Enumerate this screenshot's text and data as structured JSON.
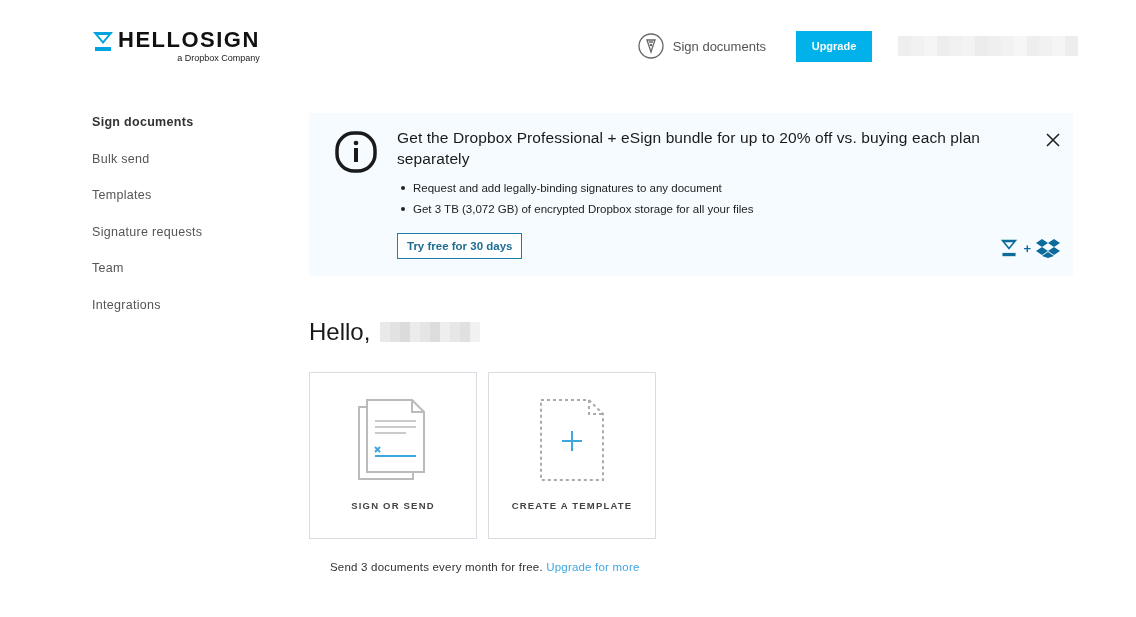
{
  "header": {
    "logo": {
      "name": "HELLOSIGN",
      "tagline": "a Dropbox Company"
    },
    "sign_link": "Sign documents",
    "upgrade_button": "Upgrade"
  },
  "sidebar": {
    "items": [
      {
        "label": "Sign documents",
        "selected": true
      },
      {
        "label": "Bulk send",
        "selected": false
      },
      {
        "label": "Templates",
        "selected": false
      },
      {
        "label": "Signature requests",
        "selected": false
      },
      {
        "label": "Team",
        "selected": false
      },
      {
        "label": "Integrations",
        "selected": false
      }
    ]
  },
  "banner": {
    "title": "Get the Dropbox Professional + eSign bundle for up to 20% off vs. buying each plan separately",
    "bullets": [
      "Request and add legally-binding signatures to any document",
      "Get 3 TB (3,072 GB) of encrypted Dropbox storage for all your files"
    ],
    "button": "Try free for 30 days",
    "plus": "+"
  },
  "greeting": "Hello,",
  "cards": [
    {
      "kind": "sign",
      "label": "SIGN OR SEND"
    },
    {
      "kind": "template",
      "label": "CREATE A TEMPLATE"
    }
  ],
  "footer": {
    "text": "Send 3 documents every month for free.",
    "link": "Upgrade for more"
  }
}
